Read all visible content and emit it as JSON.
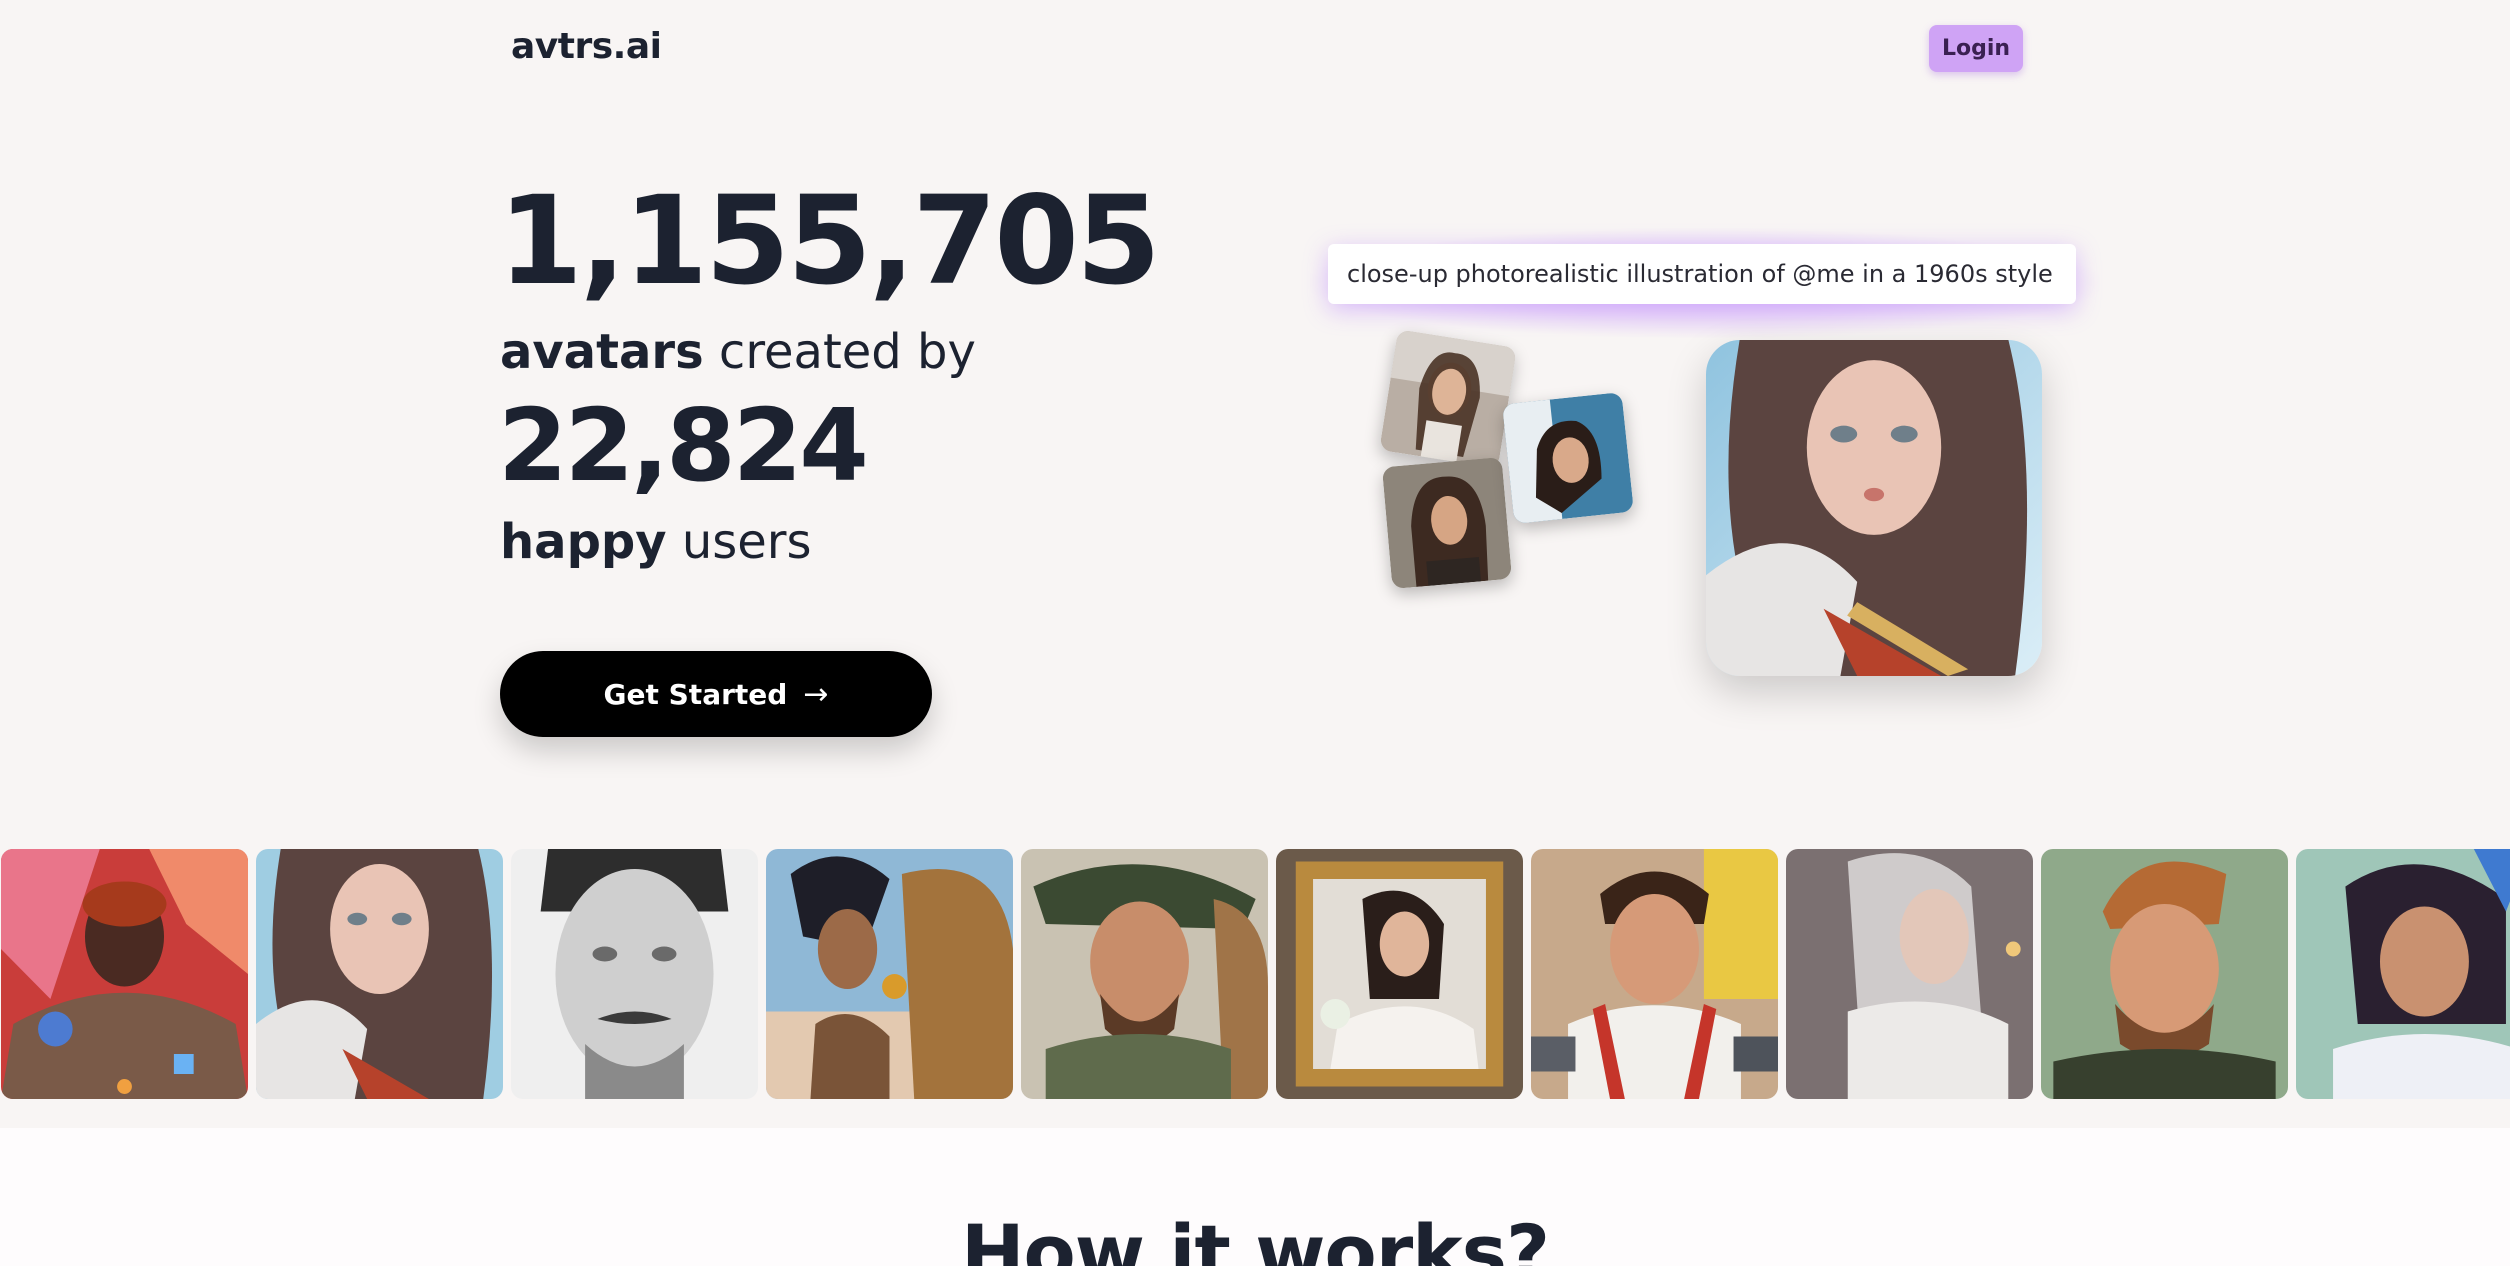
{
  "header": {
    "logo": "avtrs.ai",
    "login_label": "Login"
  },
  "hero": {
    "avatars_count": "1,155,705",
    "avatars_bold": "avatars",
    "avatars_suffix": "created by",
    "users_count": "22,824",
    "users_bold": "happy",
    "users_suffix": "users",
    "cta_label": "Get Started",
    "cta_icon": "arrow-right-icon",
    "prompt_text": "close-up photorealistic illustration of @me in a 1960s style"
  },
  "colors": {
    "background": "#f8f5f4",
    "login_bg": "#cfa3f5",
    "cta_bg": "#000000",
    "text": "#1c2230",
    "glow": "#c48cff"
  },
  "gallery": {
    "images": [
      "futuristic-armored-man-portrait",
      "anime-woman-fur-collar-portrait",
      "pencil-sketch-man-portrait",
      "woman-with-camel-portrait",
      "bearded-man-with-camel-portrait",
      "framed-woman-painting-portrait",
      "1950s-man-street-portrait",
      "silver-haired-woman-portrait",
      "cartoon-bearded-man-portrait",
      "cartoon-girl-hoodie-portrait"
    ]
  },
  "how_it_works": {
    "title": "How it works?"
  }
}
